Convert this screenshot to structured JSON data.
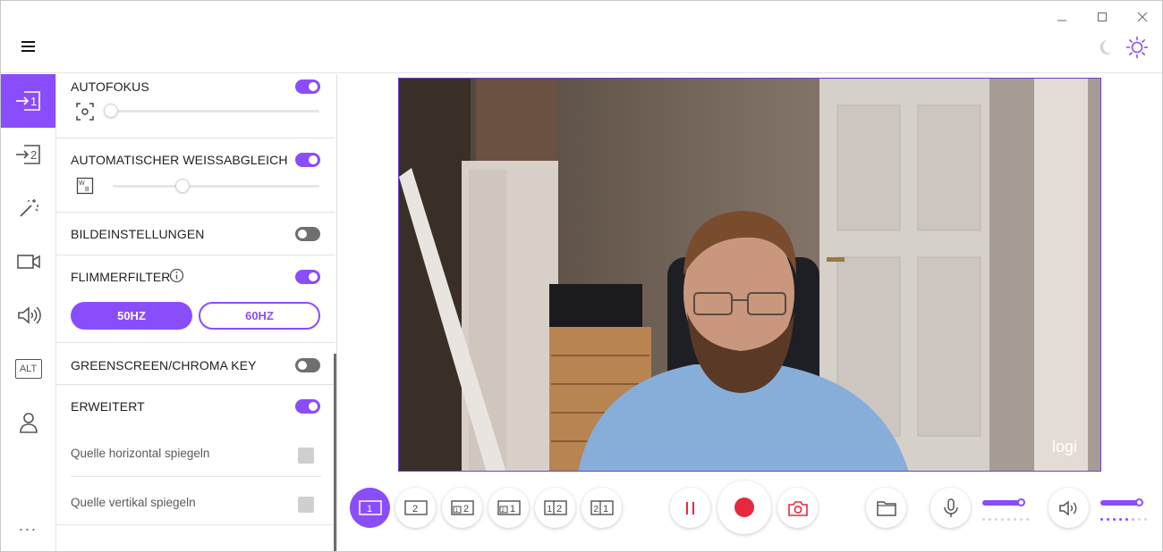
{
  "window": {
    "controls": [
      "minimize-icon",
      "maximize-icon",
      "close-icon"
    ]
  },
  "header": {
    "menu_icon": "hamburger-menu-icon",
    "theme_icons": [
      "moon-icon",
      "sun-icon"
    ]
  },
  "rail": {
    "items": [
      {
        "id": "source-1",
        "icon": "source-1-icon",
        "active": true
      },
      {
        "id": "source-2",
        "icon": "source-2-icon",
        "active": false
      },
      {
        "id": "effects",
        "icon": "magic-wand-icon",
        "active": false
      },
      {
        "id": "camera",
        "icon": "camera-icon",
        "active": false
      },
      {
        "id": "audio",
        "icon": "speaker-icon",
        "active": false
      },
      {
        "id": "alt",
        "icon": "alt-icon",
        "label": "ALT",
        "active": false
      },
      {
        "id": "account",
        "icon": "person-icon",
        "active": false
      }
    ],
    "more": "..."
  },
  "settings": {
    "autofocus": {
      "label": "AUTOFOKUS",
      "enabled": true,
      "slider_value": 0.0
    },
    "white_balance": {
      "label": "AUTOMATISCHER WEISSABGLEICH",
      "enabled": true,
      "slider_value": 0.35
    },
    "image_settings": {
      "label": "BILDEINSTELLUNGEN",
      "enabled": false
    },
    "flicker": {
      "label": "FLIMMERFILTER",
      "enabled": true,
      "options": [
        "50HZ",
        "60HZ"
      ],
      "selected": "50HZ"
    },
    "greenscreen": {
      "label": "GREENSCREEN/CHROMA KEY",
      "enabled": false
    },
    "advanced": {
      "label": "ERWEITERT",
      "enabled": true,
      "options": [
        {
          "label": "Quelle horizontal spiegeln",
          "checked": false
        },
        {
          "label": "Quelle vertikal spiegeln",
          "checked": false
        }
      ]
    }
  },
  "preview": {
    "watermark": "logi"
  },
  "toolbar": {
    "layouts": [
      {
        "id": "layout-1",
        "labels": [
          "1"
        ],
        "active": true
      },
      {
        "id": "layout-2",
        "labels": [
          "2"
        ],
        "active": false
      },
      {
        "id": "layout-pip-1-2",
        "labels": [
          "1",
          "2"
        ],
        "active": false
      },
      {
        "id": "layout-pip-2-1",
        "labels": [
          "2",
          "1"
        ],
        "active": false
      },
      {
        "id": "layout-split-1-2",
        "labels": [
          "1",
          "2"
        ],
        "active": false
      },
      {
        "id": "layout-split-2-1",
        "labels": [
          "2",
          "1"
        ],
        "active": false
      }
    ],
    "pause_icon": "pause-icon",
    "record_icon": "record-icon",
    "snapshot_icon": "camera-snapshot-icon",
    "folder_icon": "folder-icon",
    "mic": {
      "icon": "microphone-icon",
      "level": 1.0
    },
    "speaker": {
      "icon": "speaker-volume-icon",
      "level": 1.0
    },
    "accent": "#8a4dfb",
    "record_color": "#e8283f"
  }
}
